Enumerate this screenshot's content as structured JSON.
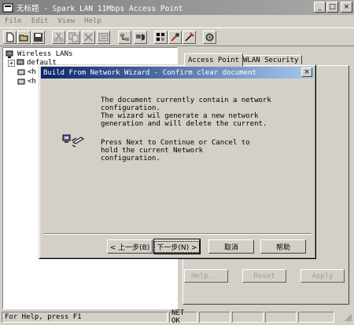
{
  "window": {
    "title": "无标题 - Spark LAN 11Mbps Access Point",
    "minimize": "_",
    "maximize": "□",
    "close": "×"
  },
  "menu": [
    "File",
    "Edit",
    "View",
    "Help"
  ],
  "toolbar": {
    "icons": [
      "new-icon",
      "open-icon",
      "save-icon",
      "cut-icon",
      "copy-icon",
      "delete-icon",
      "properties-icon",
      "network-scan-icon",
      "access-point-icon",
      "tools-icon",
      "probe-icon",
      "settings-icon"
    ]
  },
  "tree": {
    "root": "Wireless LANs",
    "child": "default",
    "item2": "<h",
    "item3": "<h"
  },
  "tabs": [
    "Access Point",
    "WLAN Security"
  ],
  "props": {
    "help": "Help...",
    "reset": "Reset",
    "apply": "Apply"
  },
  "status": {
    "help": "For Help, press F1",
    "net": "NET OK"
  },
  "dialog": {
    "title": "Build From Network Wizard - Confirm clear document",
    "close": "×",
    "message1": "The document currently contain a network\nconfiguration.\nThe wizard wil generate a new network\ngeneration and will delete the current.",
    "message2": "Press Next to Continue or Cancel to\nhold the current Network\nconfiguration.",
    "back": "< 上一步(B)",
    "next": "下一步(N) >",
    "cancel": "取消",
    "help": "帮助"
  },
  "colors": {
    "dialog_title_start": "#0a246a",
    "dialog_title_end": "#a6caf0",
    "inactive_title": "#808080",
    "face": "#d4d0c8"
  }
}
